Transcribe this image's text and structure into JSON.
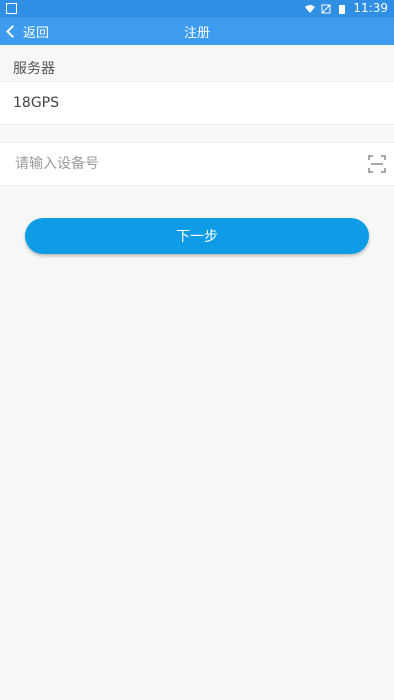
{
  "statusbar": {
    "time": "11:39",
    "icons": [
      "image-icon",
      "wifi-icon",
      "no-sim-icon",
      "battery-icon"
    ]
  },
  "header": {
    "back_label": "返回",
    "title": "注册"
  },
  "server": {
    "section_label": "服务器",
    "value": "18GPS"
  },
  "device": {
    "placeholder": "请输入设备号",
    "value": "",
    "scan_icon": "scan-icon"
  },
  "primary_button": {
    "label": "下一步"
  },
  "colors": {
    "statusbar": "#2f8fe4",
    "appbar": "#3d9cf0",
    "button": "#0e9ce7",
    "background": "#f7f7f7"
  }
}
